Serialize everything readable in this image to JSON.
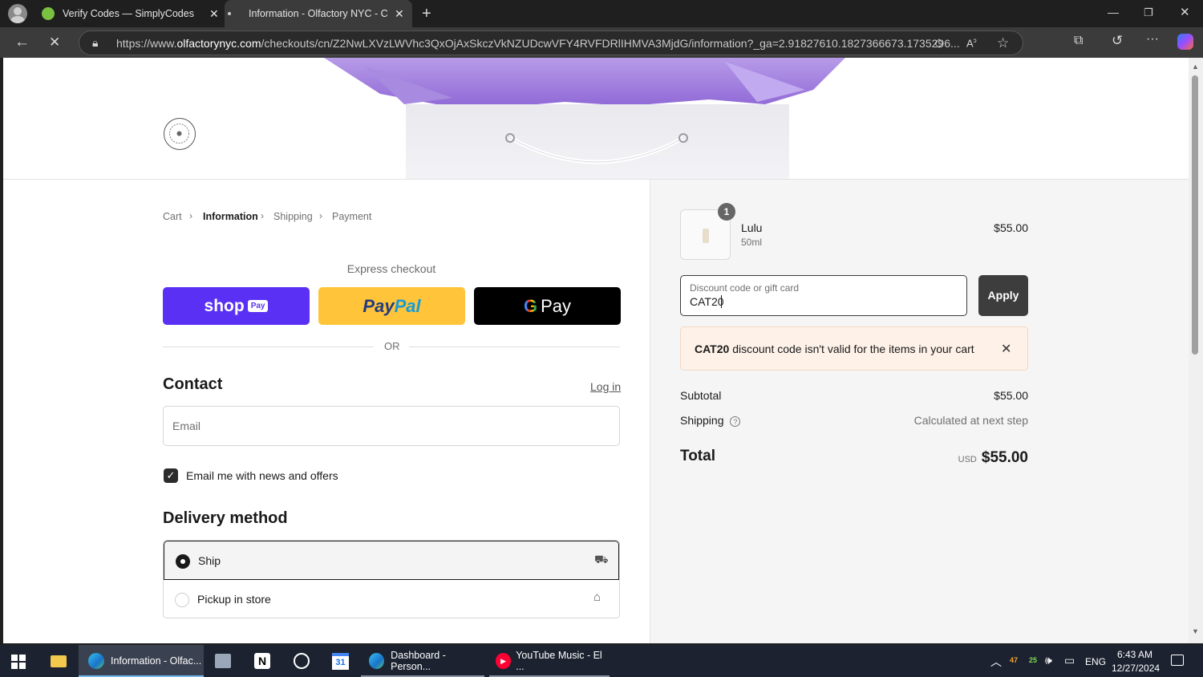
{
  "browser": {
    "tabs": [
      {
        "title": "Verify Codes — SimplyCodes"
      },
      {
        "title": "Information - Olfactory NYC - Ch"
      }
    ],
    "url_prefix": "https://www.",
    "url_domain": "olfactorynyc.com",
    "url_rest": "/checkouts/cn/Z2NwLXVzLWVhc3QxOjAxSkczVkNZUDcwVFY4RVFDRlIHMVA3MjdG/information?_ga=2.91827610.1827366673.1735296..."
  },
  "checkout": {
    "breadcrumb": {
      "cart": "Cart",
      "information": "Information",
      "shipping": "Shipping",
      "payment": "Payment"
    },
    "express_checkout": "Express checkout",
    "shop_pay": {
      "shop": "shop",
      "pay": "Pay"
    },
    "paypal": {
      "pay": "Pay",
      "pal": "Pal"
    },
    "gpay": {
      "g": "G",
      "pay": "Pay"
    },
    "or": "OR",
    "contact": {
      "heading": "Contact",
      "login": "Log in",
      "email_placeholder": "Email",
      "newsletter_label": "Email me with news and offers",
      "newsletter_checked": true
    },
    "delivery": {
      "heading": "Delivery method",
      "options": [
        {
          "label": "Ship",
          "selected": true
        },
        {
          "label": "Pickup in store",
          "selected": false
        }
      ]
    }
  },
  "summary": {
    "item": {
      "qty": "1",
      "name": "Lulu",
      "variant": "50ml",
      "price": "$55.00"
    },
    "discount": {
      "label": "Discount code or gift card",
      "value": "CAT20",
      "apply": "Apply"
    },
    "error": {
      "code": "CAT20",
      "message": " discount code isn't valid for the items in your cart"
    },
    "subtotal_label": "Subtotal",
    "subtotal": "$55.00",
    "shipping_label": "Shipping",
    "shipping_value": "Calculated at next step",
    "total_label": "Total",
    "currency": "USD",
    "total": "$55.00"
  },
  "taskbar": {
    "items": [
      {
        "label": "Information - Olfac..."
      },
      {
        "label": "Dashboard - Person..."
      },
      {
        "label": "YouTube Music - El ..."
      }
    ],
    "calendar_day": "31",
    "lang": "ENG",
    "time": "6:43 AM",
    "date": "12/27/2024"
  },
  "colors": {
    "shop_pay": "#5a31f4",
    "paypal": "#ffc439",
    "gpay": "#000000",
    "apply": "#3d3d3d",
    "error_bg": "#fdf1e8"
  }
}
